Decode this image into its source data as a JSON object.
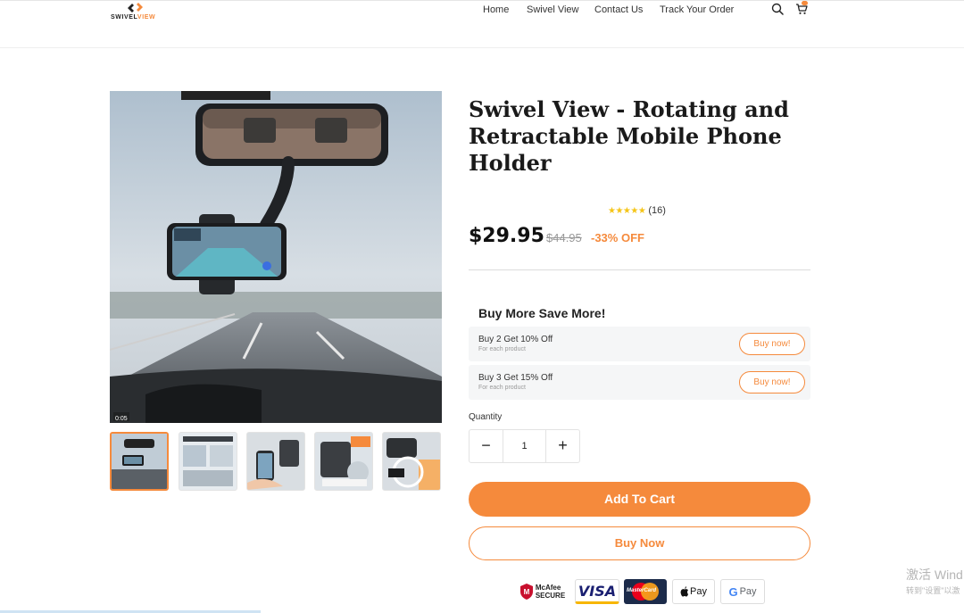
{
  "header": {
    "logo_text_dark": "SWIVEL",
    "logo_text_accent": "VIEW",
    "nav": [
      "Home",
      "Swivel View",
      "Contact Us",
      "Track Your Order"
    ],
    "icons": [
      "search-icon",
      "cart-icon"
    ]
  },
  "gallery": {
    "video_time": "0:05",
    "thumb_count": 5,
    "active_thumb": 1
  },
  "product": {
    "title": "Swivel View - Rotating and Retractable Mobile Phone Holder",
    "stars": "★★★★★",
    "rating_value": 5,
    "review_count": "(16)",
    "price": "$29.95",
    "compare_price": "$44.95",
    "discount": "-33% OFF"
  },
  "bundle": {
    "title": "Buy More Save More!",
    "offers": [
      {
        "label": "Buy 2 Get 10% Off",
        "sub": "For each product",
        "button": "Buy now!"
      },
      {
        "label": "Buy 3 Get 15% Off",
        "sub": "For each product",
        "button": "Buy now!"
      }
    ]
  },
  "quantity": {
    "label": "Quantity",
    "value": "1",
    "minus": "−",
    "plus": "+"
  },
  "actions": {
    "add_to_cart": "Add To Cart",
    "buy_now": "Buy Now"
  },
  "payments": {
    "mcafee_line1": "McAfee",
    "mcafee_line2": "SECURE",
    "visa": "VISA",
    "mastercard": "MasterCard",
    "applepay": "Pay",
    "googlepay": "Pay"
  },
  "windows_watermark": {
    "line1": "激活 Wind",
    "line2": "转到\"设置\"以激"
  },
  "colors": {
    "accent": "#f58a3c",
    "star": "#f5c518",
    "text": "#1a1a1a"
  }
}
